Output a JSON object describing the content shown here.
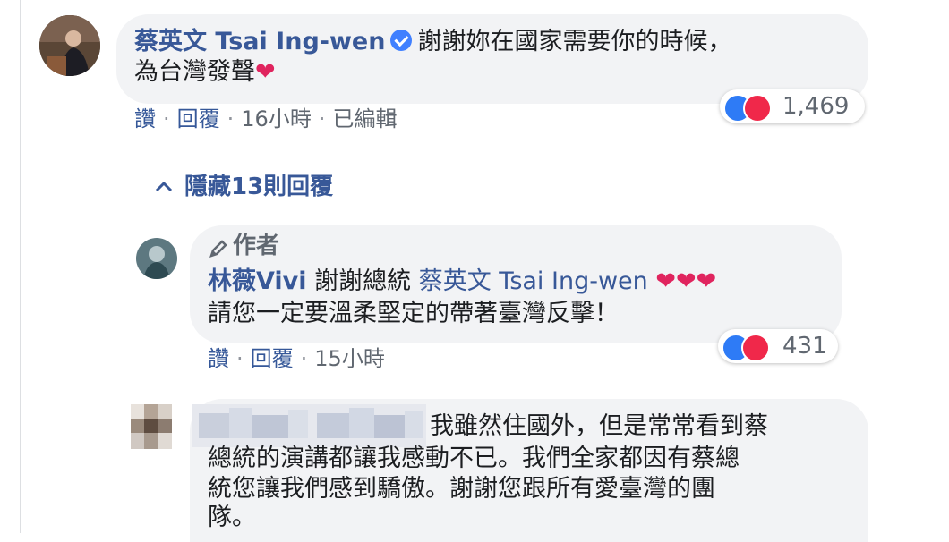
{
  "comment1": {
    "author": "蔡英文 Tsai Ing-wen",
    "line1": "謝謝妳在國家需要你的時候，",
    "line2": "為台灣發聲",
    "heart": "❤",
    "actions": {
      "like": "讚",
      "reply": "回覆",
      "time": "16小時",
      "edited": "已編輯"
    },
    "reaction_count": "1,469"
  },
  "replies_toggle": {
    "icon": "chevron-up-icon",
    "label": "隱藏13則回覆"
  },
  "reply1": {
    "badge": "作者",
    "author": "林薇Vivi",
    "text_before": "謝謝總統",
    "mention": "蔡英文 Tsai Ing-wen",
    "hearts": "❤❤❤",
    "line2": "請您一定要溫柔堅定的帶著臺灣反擊！",
    "actions": {
      "like": "讚",
      "reply": "回覆",
      "time": "15小時"
    },
    "reaction_count": "431"
  },
  "reply2": {
    "line1": "我雖然住國外，但是常常看到蔡",
    "line2": "總統的演講都讓我感動不已。我們全家都因有蔡總",
    "line3": "統您讓我們感到驕傲。謝謝您跟所有愛臺灣的團",
    "line4": "隊。"
  },
  "colors": {
    "link": "#385898",
    "bubble": "#f2f3f5",
    "like": "#2e7bf6",
    "love": "#f0284a"
  }
}
